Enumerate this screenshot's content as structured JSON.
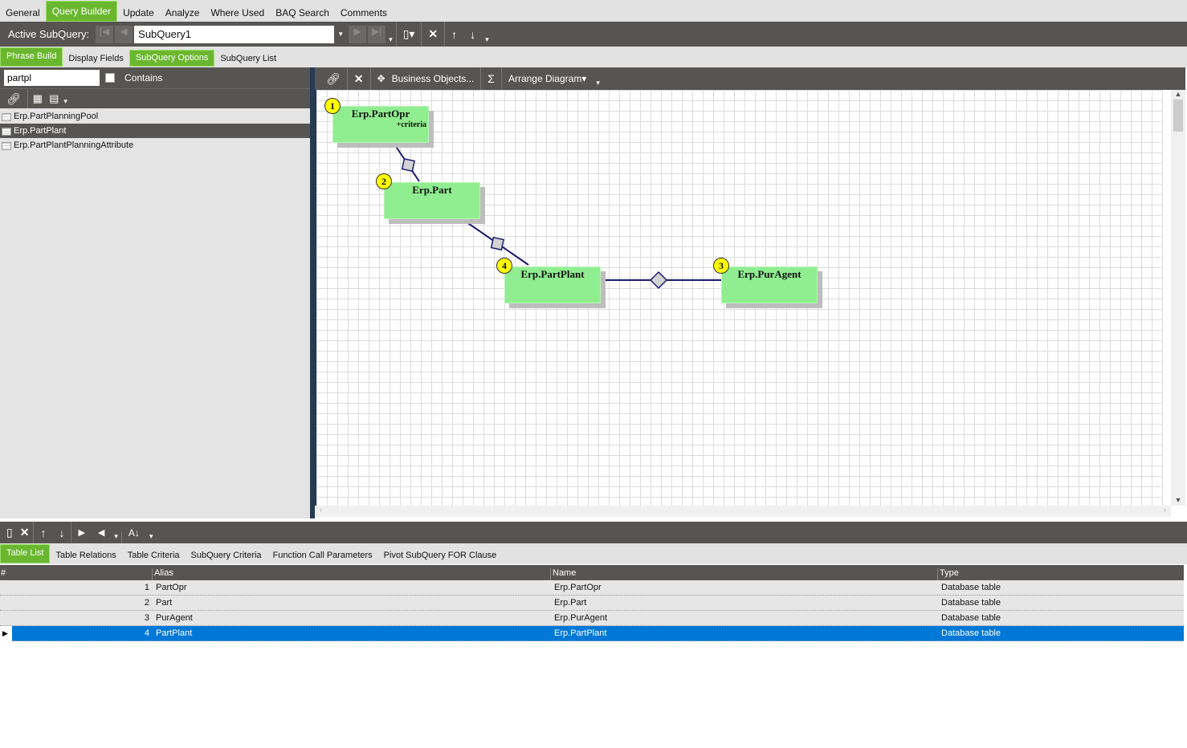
{
  "top_tabs": [
    "General",
    "Query Builder",
    "Update",
    "Analyze",
    "Where Used",
    "BAQ Search",
    "Comments"
  ],
  "active_top_tab": "Query Builder",
  "subquery": {
    "label": "Active SubQuery:",
    "value": "SubQuery1"
  },
  "sub_tabs": [
    "Phrase Build",
    "Display Fields",
    "SubQuery Options",
    "SubQuery List"
  ],
  "search": {
    "value": "partpl",
    "contains_label": "Contains"
  },
  "tables": [
    "Erp.PartPlanningPool",
    "Erp.PartPlant",
    "Erp.PartPlantPlanningAttribute"
  ],
  "selected_table": "Erp.PartPlant",
  "diagram_toolbar": {
    "business_objects": "Business Objects...",
    "sum": "Σ",
    "arrange": "Arrange Diagram"
  },
  "nodes": [
    {
      "num": "1",
      "name": "Erp.PartOpr",
      "note": "+criteria"
    },
    {
      "num": "2",
      "name": "Erp.Part",
      "note": ""
    },
    {
      "num": "4",
      "name": "Erp.PartPlant",
      "note": ""
    },
    {
      "num": "3",
      "name": "Erp.PurAgent",
      "note": ""
    }
  ],
  "bottom_tabs": [
    "Table List",
    "Table Relations",
    "Table Criteria",
    "SubQuery Criteria",
    "Function Call Parameters",
    "Pivot SubQuery FOR Clause"
  ],
  "grid": {
    "headers": [
      "#",
      "Alias",
      "Name",
      "Type"
    ],
    "rows": [
      {
        "n": "1",
        "alias": "PartOpr",
        "name": "Erp.PartOpr",
        "type": "Database table"
      },
      {
        "n": "2",
        "alias": "Part",
        "name": "Erp.Part",
        "type": "Database table"
      },
      {
        "n": "3",
        "alias": "PurAgent",
        "name": "Erp.PurAgent",
        "type": "Database table"
      },
      {
        "n": "4",
        "alias": "PartPlant",
        "name": "Erp.PartPlant",
        "type": "Database table"
      }
    ]
  },
  "colors": {
    "accent": "#6ab72f",
    "toolbar": "#575553",
    "selection": "#0078d7",
    "node": "#90ee90"
  }
}
